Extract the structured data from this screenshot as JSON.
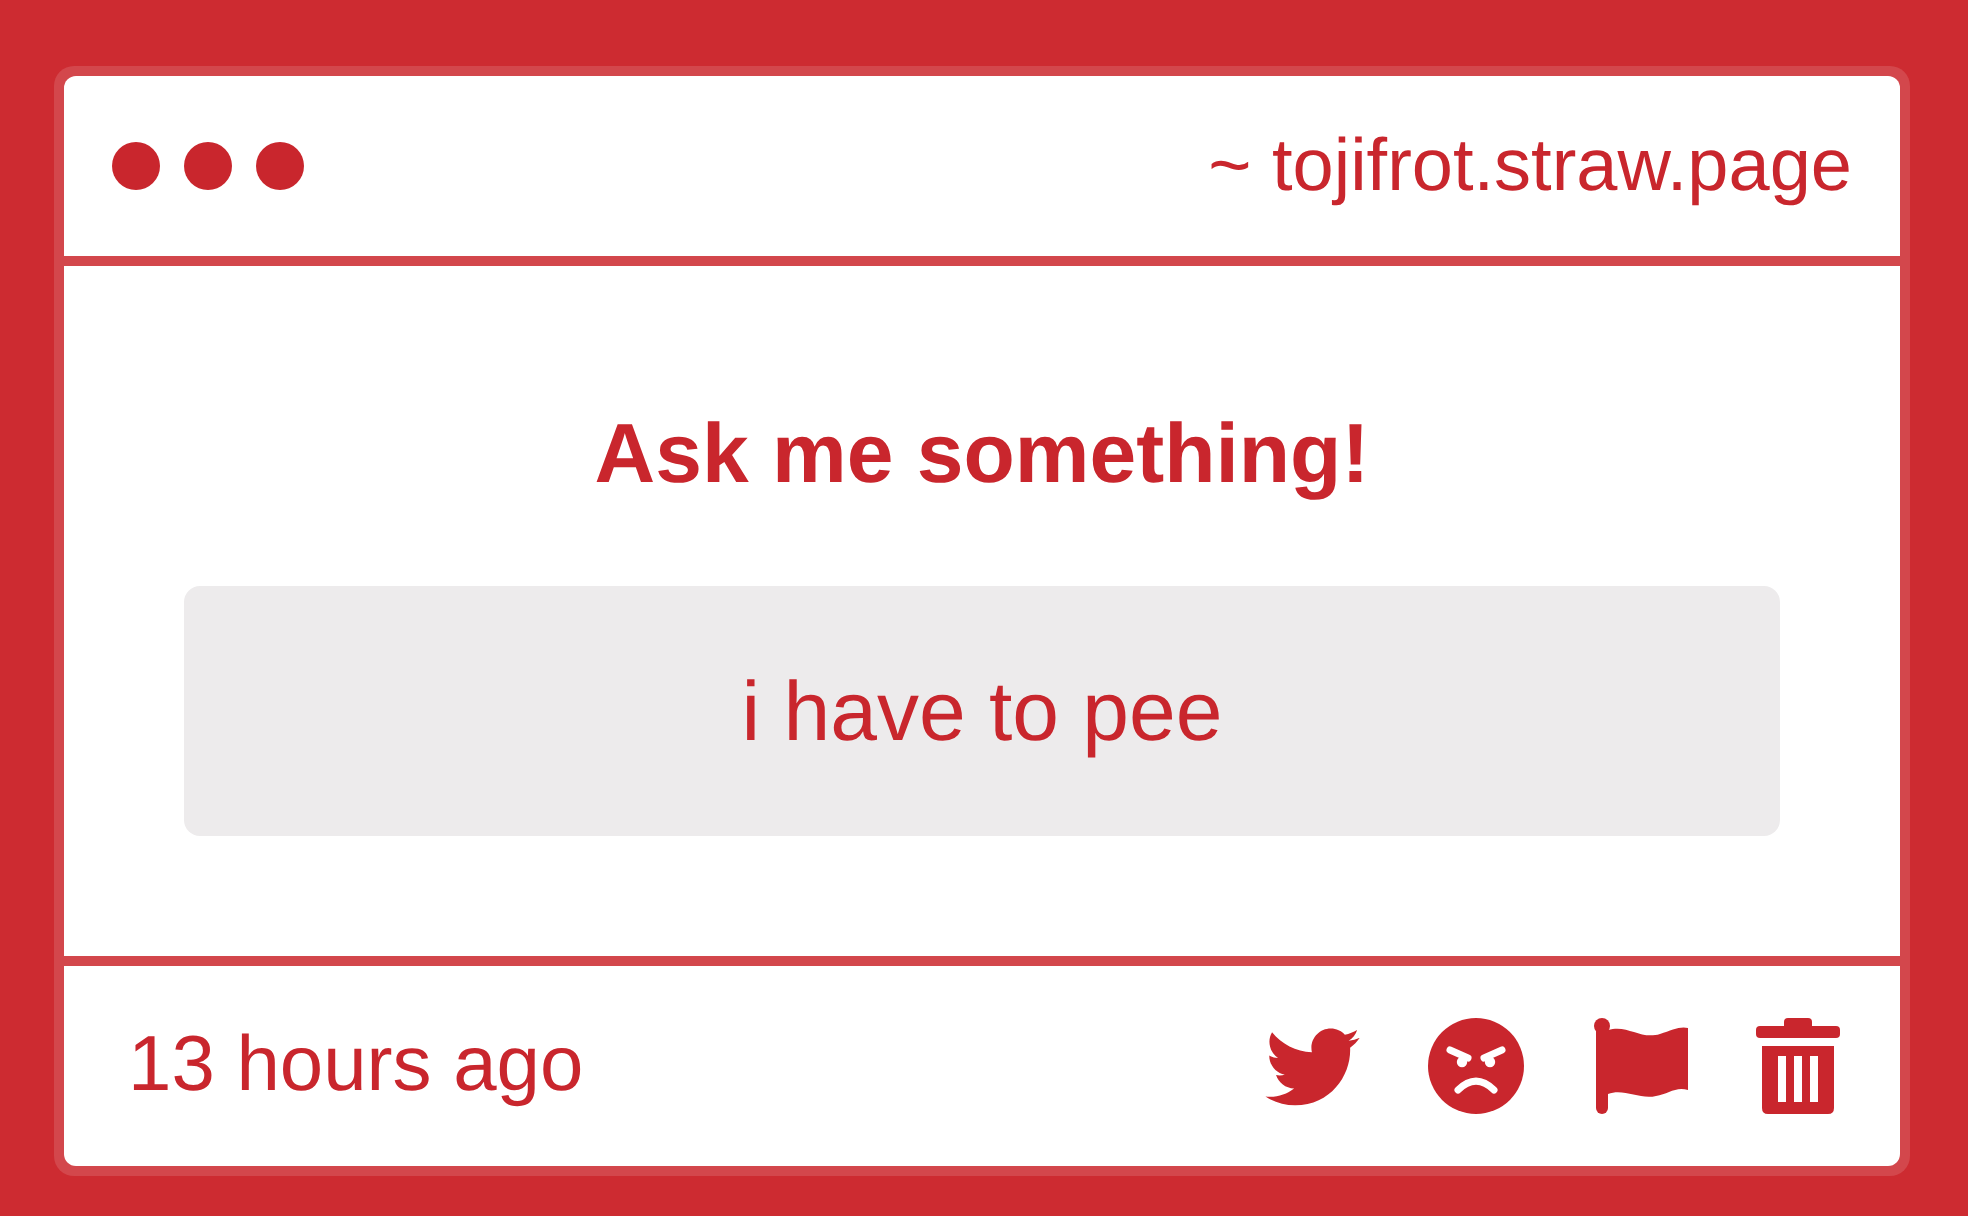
{
  "header": {
    "address": "~ tojifrot.straw.page"
  },
  "body": {
    "prompt": "Ask me something!",
    "question": "i have to pee"
  },
  "footer": {
    "timestamp": "13 hours ago"
  }
}
